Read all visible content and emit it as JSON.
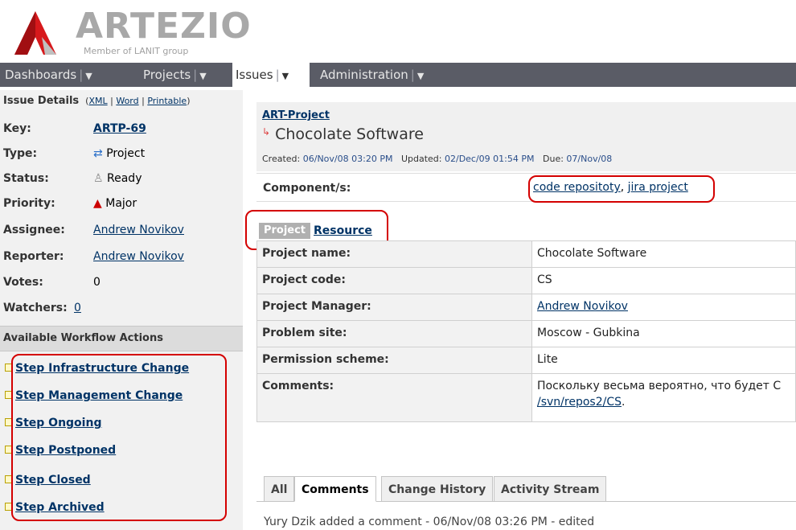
{
  "header": {
    "logo_text": "ARTEZIO",
    "logo_sub": "Member of LANIT group"
  },
  "nav": [
    {
      "label": "Dashboards"
    },
    {
      "label": "Projects"
    },
    {
      "label": "Issues"
    },
    {
      "label": "Administration"
    }
  ],
  "sidebar": {
    "title": "Issue Details",
    "title_links": {
      "xml": "XML",
      "word": "Word",
      "printable": "Printable"
    },
    "fields": [
      {
        "label": "Key:",
        "value": "ARTP-69"
      },
      {
        "label": "Type:",
        "value": "Project"
      },
      {
        "label": "Status:",
        "value": "Ready"
      },
      {
        "label": "Priority:",
        "value": "Major"
      },
      {
        "label": "Assignee:",
        "value": "Andrew Novikov"
      },
      {
        "label": "Reporter:",
        "value": "Andrew Novikov"
      },
      {
        "label": "Votes:",
        "value": "0"
      },
      {
        "label": "Watchers:",
        "value": "0"
      }
    ],
    "workflow_title": "Available Workflow Actions",
    "workflow": [
      "Step Infrastructure Change",
      "Step Management Change",
      "Step Ongoing",
      "Step Postponed",
      "Step Closed",
      "Step Archived"
    ]
  },
  "issue": {
    "project": "ART-Project",
    "title": "Chocolate Software",
    "created_label": "Created:",
    "created": "06/Nov/08 03:20 PM",
    "updated_label": "Updated:",
    "updated": "02/Dec/09 01:54 PM",
    "due_label": "Due:",
    "due": "07/Nov/08",
    "component_label": "Component/s:",
    "components": [
      "code repositoty",
      "jira project"
    ]
  },
  "tabs": {
    "project": "Project",
    "resource": "Resource"
  },
  "details": [
    {
      "key": "Project name:",
      "value": "Chocolate Software"
    },
    {
      "key": "Project code:",
      "value": "CS"
    },
    {
      "key": "Project Manager:",
      "value": "Andrew Novikov"
    },
    {
      "key": "Problem site:",
      "value": "Moscow - Gubkina"
    },
    {
      "key": "Permission scheme:",
      "value": "Lite"
    },
    {
      "key": "Comments:",
      "value": "Поскольку весьма вероятно, что будет С",
      "value2": "/svn/repos2/CS"
    }
  ],
  "bottom_tabs": [
    "All",
    "Comments",
    "Change History",
    "Activity Stream"
  ],
  "cut_text": "Yury Dzik added a comment - 06/Nov/08 03:26 PM - edited",
  "colors": {
    "navbar": "#5a5c66",
    "link": "#003366",
    "annotation": "#d40000",
    "logo_red": "#d7191c"
  }
}
